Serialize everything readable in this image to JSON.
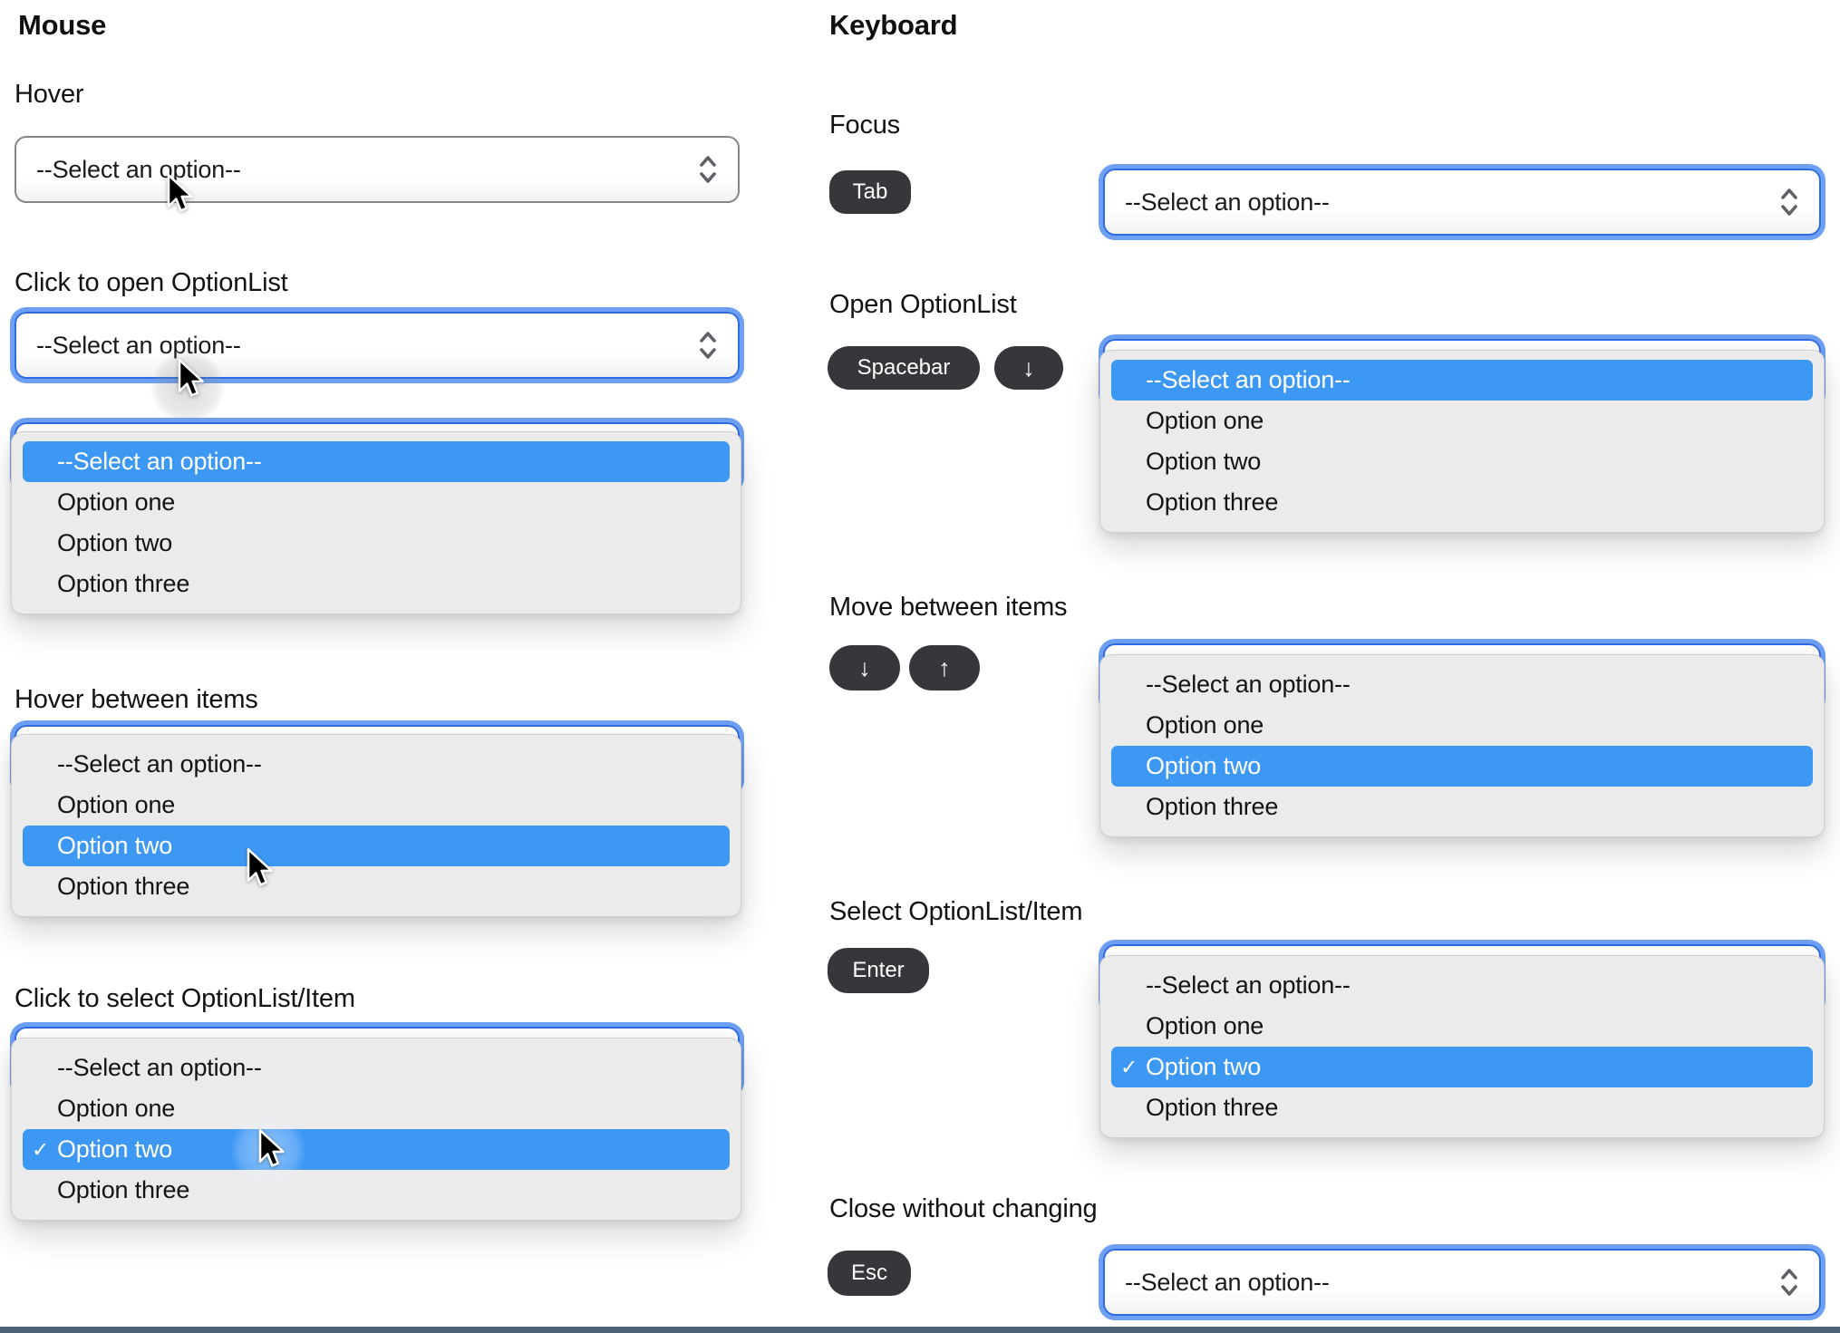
{
  "columns": {
    "mouse": {
      "title": "Mouse",
      "sections": [
        {
          "label": "Hover"
        },
        {
          "label": "Click to open OptionList"
        },
        {
          "label": "Hover between items"
        },
        {
          "label": "Click to select OptionList/Item"
        }
      ]
    },
    "keyboard": {
      "title": "Keyboard",
      "sections": [
        {
          "label": "Focus",
          "keys": [
            "Tab"
          ]
        },
        {
          "label": "Open OptionList",
          "keys": [
            "Spacebar",
            "↓"
          ]
        },
        {
          "label": "Move between items",
          "keys": [
            "↓",
            "↑"
          ]
        },
        {
          "label": "Select OptionList/Item",
          "keys": [
            "Enter"
          ]
        },
        {
          "label": "Close without changing",
          "keys": [
            "Esc"
          ]
        }
      ]
    }
  },
  "select": {
    "value": "--Select an option--",
    "options": [
      "--Select an option--",
      "Option one",
      "Option two",
      "Option three"
    ]
  },
  "icons": {
    "check": "✓",
    "stepper": "up-down-chevrons"
  },
  "colors": {
    "highlight": "#3d98f4",
    "focus_ring_outer": "#6d9ff4",
    "focus_ring_inner": "#2f6ce2",
    "key_pill": "#37373b",
    "bottom_divider": "#4e6377"
  }
}
